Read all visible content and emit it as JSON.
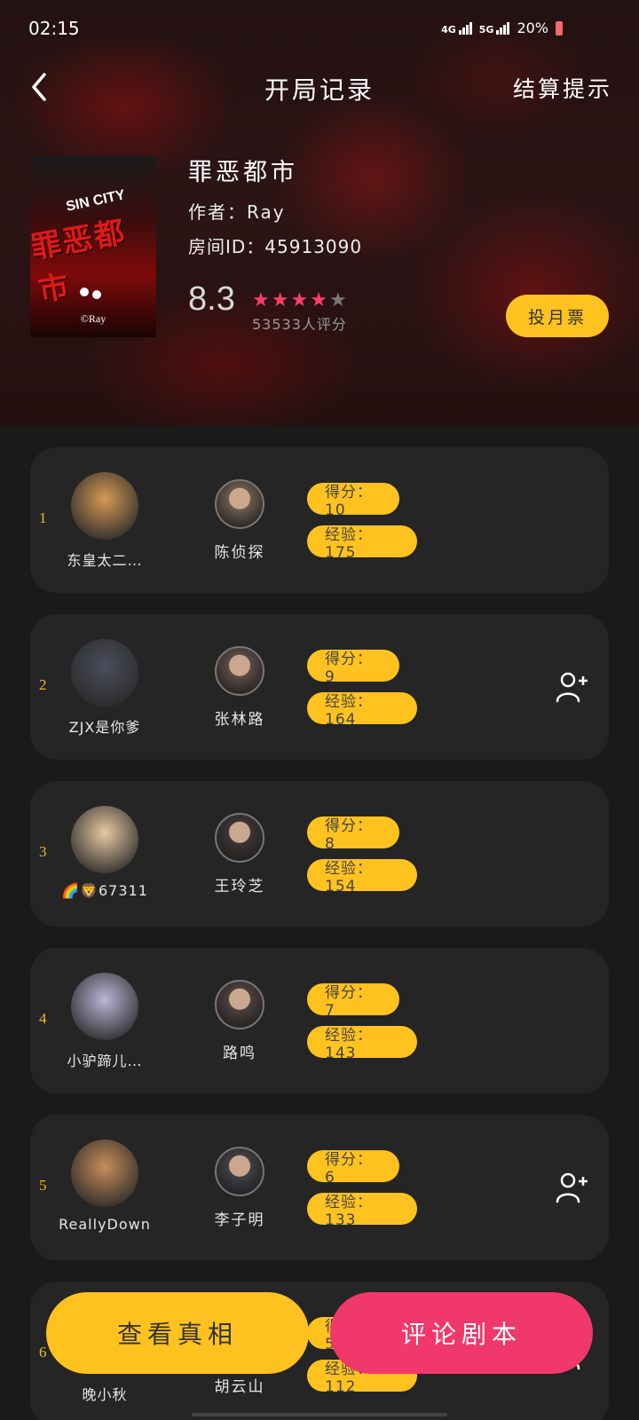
{
  "status": {
    "time": "02:15",
    "net1": "4G",
    "net2": "5G",
    "battery": "20%"
  },
  "nav": {
    "title": "开局记录",
    "settle_link": "结算提示",
    "back_icon": "chevron-left-icon"
  },
  "drama": {
    "cover": {
      "sin_city": "SIN CITY",
      "title_art": "罪恶都市",
      "credit": "©Ray"
    },
    "title": "罪恶都市",
    "author": "作者：Ray",
    "room": "房间ID：45913090",
    "score": "8.3",
    "stars": 4,
    "star_max": 5,
    "rating_count": "53533人评分",
    "vote_label": "投月票"
  },
  "records": [
    {
      "rank": "1",
      "player": "东皇太二…",
      "role": "陈侦探",
      "score": "得分：10",
      "exp": "经验：175",
      "add_friend": false,
      "avatar_color": "#d69a55",
      "role_color": "#6b5a4e"
    },
    {
      "rank": "2",
      "player": "ZJX是你爹",
      "role": "张林路",
      "score": "得分：9",
      "exp": "经验：164",
      "add_friend": true,
      "avatar_color": "#4a4e5c",
      "role_color": "#5a4a44"
    },
    {
      "rank": "3",
      "player": "🌈🦁67311",
      "role": "王玲芝",
      "score": "得分：8",
      "exp": "经验：154",
      "add_friend": false,
      "avatar_color": "#e8c9a2",
      "role_color": "#3b3434"
    },
    {
      "rank": "4",
      "player": "小驴蹄儿…",
      "role": "路鸣",
      "score": "得分：7",
      "exp": "经验：143",
      "add_friend": false,
      "avatar_color": "#b9b6d6",
      "role_color": "#4a3f3c"
    },
    {
      "rank": "5",
      "player": "ReallyDown",
      "role": "李子明",
      "score": "得分：6",
      "exp": "经验：133",
      "add_friend": true,
      "avatar_color": "#c88d5a",
      "role_color": "#3e3e44"
    },
    {
      "rank": "6",
      "player": "晚小秋",
      "role": "胡云山",
      "score": "得分：5",
      "exp": "经验：112",
      "add_friend": true,
      "avatar_color": "#7a6a5a",
      "role_color": "#4b4444"
    }
  ],
  "actions": {
    "truth_label": "查看真相",
    "review_label": "评论剧本"
  },
  "colors": {
    "accent_yellow": "#ffc21f",
    "accent_pink": "#f0386a",
    "card": "#252525",
    "background": "#1a1a1a"
  }
}
